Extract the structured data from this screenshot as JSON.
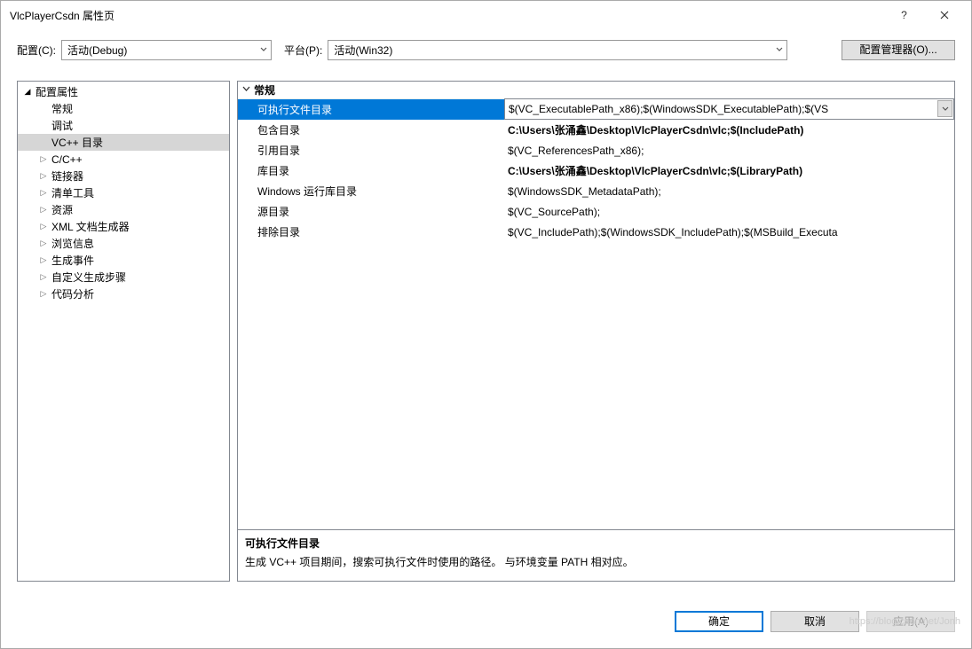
{
  "window": {
    "title": "VlcPlayerCsdn 属性页"
  },
  "toolbar": {
    "config_label": "配置(C):",
    "config_value": "活动(Debug)",
    "platform_label": "平台(P):",
    "platform_value": "活动(Win32)",
    "config_mgr_label": "配置管理器(O)..."
  },
  "tree": {
    "root_label": "配置属性",
    "items": [
      {
        "label": "常规",
        "level": 1,
        "expander": ""
      },
      {
        "label": "调试",
        "level": 1,
        "expander": ""
      },
      {
        "label": "VC++ 目录",
        "level": 1,
        "expander": "",
        "selected": true
      },
      {
        "label": "C/C++",
        "level": 1,
        "expander": "closed"
      },
      {
        "label": "链接器",
        "level": 1,
        "expander": "closed"
      },
      {
        "label": "清单工具",
        "level": 1,
        "expander": "closed"
      },
      {
        "label": "资源",
        "level": 1,
        "expander": "closed"
      },
      {
        "label": "XML 文档生成器",
        "level": 1,
        "expander": "closed"
      },
      {
        "label": "浏览信息",
        "level": 1,
        "expander": "closed"
      },
      {
        "label": "生成事件",
        "level": 1,
        "expander": "closed"
      },
      {
        "label": "自定义生成步骤",
        "level": 1,
        "expander": "closed"
      },
      {
        "label": "代码分析",
        "level": 1,
        "expander": "closed"
      }
    ]
  },
  "grid": {
    "group_title": "常规",
    "rows": [
      {
        "name": "可执行文件目录",
        "value": "$(VC_ExecutablePath_x86);$(WindowsSDK_ExecutablePath);$(VS",
        "selected": true
      },
      {
        "name": "包含目录",
        "value": "C:\\Users\\张涌鑫\\Desktop\\VlcPlayerCsdn\\vlc;$(IncludePath)",
        "bold": true
      },
      {
        "name": "引用目录",
        "value": "$(VC_ReferencesPath_x86);"
      },
      {
        "name": "库目录",
        "value": "C:\\Users\\张涌鑫\\Desktop\\VlcPlayerCsdn\\vlc;$(LibraryPath)",
        "bold": true
      },
      {
        "name": "Windows 运行库目录",
        "value": "$(WindowsSDK_MetadataPath);"
      },
      {
        "name": "源目录",
        "value": "$(VC_SourcePath);"
      },
      {
        "name": "排除目录",
        "value": "$(VC_IncludePath);$(WindowsSDK_IncludePath);$(MSBuild_Executa"
      }
    ]
  },
  "description": {
    "title": "可执行文件目录",
    "body": "生成 VC++ 项目期间，搜索可执行文件时使用的路径。 与环境变量 PATH 相对应。"
  },
  "buttons": {
    "ok": "确定",
    "cancel": "取消",
    "apply": "应用(A)"
  },
  "watermark": "https://blog.csdn.net/Jonh"
}
